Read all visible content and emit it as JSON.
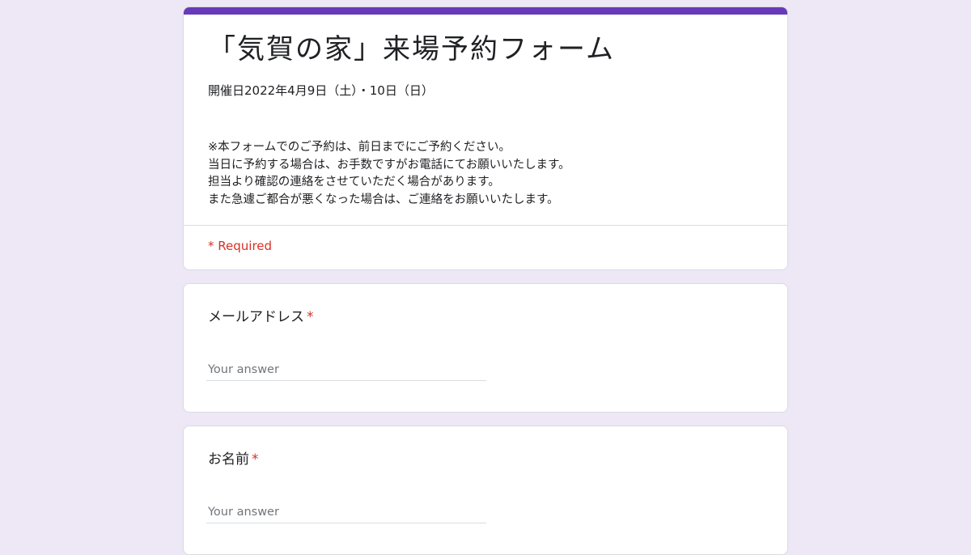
{
  "header": {
    "title": "「気賀の家」来場予約フォーム",
    "event_date": "開催日2022年4月9日（土）・10日（日）",
    "description": [
      "※本フォームでのご予約は、前日までにご予約ください。",
      "当日に予約する場合は、お手数ですがお電話にてお願いいたします。",
      "担当より確認の連絡をさせていただく場合があります。",
      "また急遽ご都合が悪くなった場合は、ご連絡をお願いいたします。"
    ],
    "required_note": "* Required"
  },
  "questions": [
    {
      "label": "メールアドレス",
      "required_mark": "*",
      "placeholder": "Your answer"
    },
    {
      "label": "お名前",
      "required_mark": "*",
      "placeholder": "Your answer"
    }
  ],
  "colors": {
    "accent": "#673ab7",
    "background": "#ede7f6",
    "required": "#d93025"
  }
}
